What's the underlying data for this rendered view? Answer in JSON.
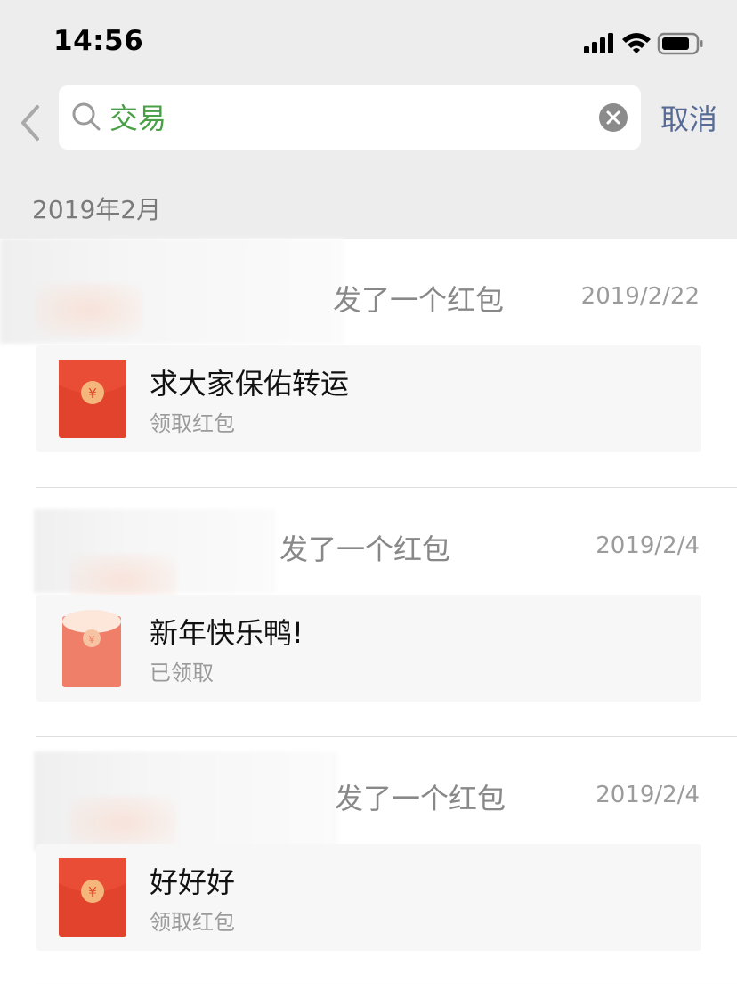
{
  "status_bar": {
    "time": "14:56"
  },
  "search": {
    "query": "交易",
    "cancel_label": "取消"
  },
  "section_header": "2019年2月",
  "records": [
    {
      "action": "发了一个红包",
      "date": "2019/2/22",
      "card_title": "求大家保佑转运",
      "card_status": "领取红包",
      "opened": false
    },
    {
      "action": "发了一个红包",
      "date": "2019/2/4",
      "card_title": "新年快乐鸭!",
      "card_status": "已领取",
      "opened": true
    },
    {
      "action": "发了一个红包",
      "date": "2019/2/4",
      "card_title": "好好好",
      "card_status": "领取红包",
      "opened": false
    }
  ],
  "icons": {
    "back": "chevron-left-icon",
    "search": "search-icon",
    "clear": "clear-icon",
    "red_packet": "red-packet-icon",
    "yen_symbol": "¥"
  },
  "colors": {
    "search_query": "#4aa046",
    "cancel": "#576b95",
    "red_packet": "#e2432d",
    "red_packet_opened": "#f07f6a",
    "coin": "#f4b67a"
  }
}
